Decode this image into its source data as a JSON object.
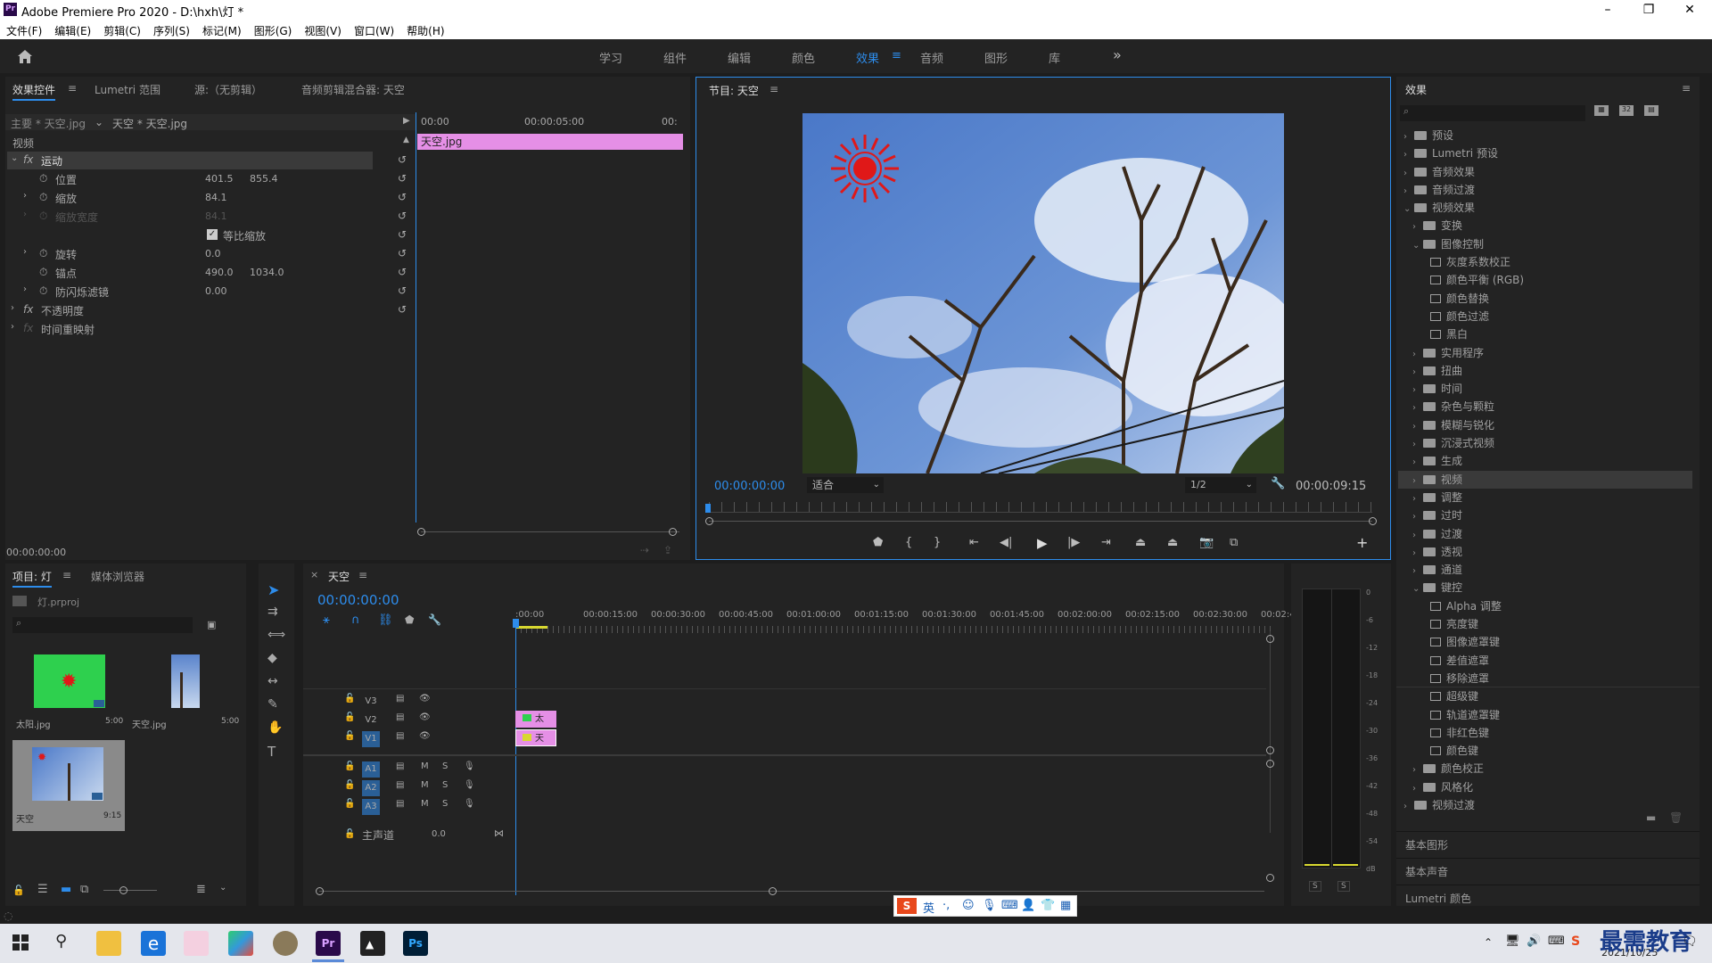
{
  "window": {
    "title": "Adobe Premiere Pro 2020 - D:\\hxh\\灯 *",
    "app_icon": "Pr"
  },
  "menu": [
    "文件(F)",
    "编辑(E)",
    "剪辑(C)",
    "序列(S)",
    "标记(M)",
    "图形(G)",
    "视图(V)",
    "窗口(W)",
    "帮助(H)"
  ],
  "workspaces": {
    "items": [
      "学习",
      "组件",
      "编辑",
      "颜色",
      "效果",
      "音频",
      "图形",
      "库"
    ],
    "active": "效果",
    "more": "»"
  },
  "effect_controls": {
    "tabs": [
      "效果控件",
      "Lumetri 范围",
      "源:（无剪辑）",
      "音频剪辑混合器: 天空"
    ],
    "master_label": "主要 * 天空.jpg",
    "clip_label": "天空 * 天空.jpg",
    "ruler": [
      "00:00",
      "00:00:05:00",
      "00:"
    ],
    "clip_bar": "天空.jpg",
    "section_video": "视频",
    "motion": "运动",
    "props": [
      {
        "name": "位置",
        "v1": "401.5",
        "v2": "855.4"
      },
      {
        "name": "缩放",
        "v1": "84.1",
        "v2": ""
      },
      {
        "name": "缩放宽度",
        "v1": "84.1",
        "v2": ""
      },
      {
        "name": "旋转",
        "v1": "0.0",
        "v2": ""
      },
      {
        "name": "锚点",
        "v1": "490.0",
        "v2": "1034.0"
      },
      {
        "name": "防闪烁滤镜",
        "v1": "0.00",
        "v2": ""
      }
    ],
    "uniform_scale": "等比缩放",
    "opacity": "不透明度",
    "time_remap": "时间重映射",
    "timecode": "00:00:00:00"
  },
  "program": {
    "title": "节目: 天空",
    "timecode_left": "00:00:00:00",
    "fit": "适合",
    "resolution": "1/2",
    "timecode_right": "00:00:09:15"
  },
  "effects_panel": {
    "title": "效果",
    "tree": [
      {
        "level": 0,
        "type": "folder",
        "label": "预设",
        "open": false
      },
      {
        "level": 0,
        "type": "folder",
        "label": "Lumetri 预设",
        "open": false
      },
      {
        "level": 0,
        "type": "folder",
        "label": "音频效果",
        "open": false
      },
      {
        "level": 0,
        "type": "folder",
        "label": "音频过渡",
        "open": false
      },
      {
        "level": 0,
        "type": "folder",
        "label": "视频效果",
        "open": true
      },
      {
        "level": 1,
        "type": "folder",
        "label": "变换",
        "open": false
      },
      {
        "level": 1,
        "type": "folder",
        "label": "图像控制",
        "open": true
      },
      {
        "level": 2,
        "type": "fx",
        "label": "灰度系数校正"
      },
      {
        "level": 2,
        "type": "fx",
        "label": "颜色平衡 (RGB)"
      },
      {
        "level": 2,
        "type": "fx",
        "label": "颜色替换"
      },
      {
        "level": 2,
        "type": "fx",
        "label": "颜色过滤"
      },
      {
        "level": 2,
        "type": "fx",
        "label": "黑白"
      },
      {
        "level": 1,
        "type": "folder",
        "label": "实用程序",
        "open": false
      },
      {
        "level": 1,
        "type": "folder",
        "label": "扭曲",
        "open": false
      },
      {
        "level": 1,
        "type": "folder",
        "label": "时间",
        "open": false
      },
      {
        "level": 1,
        "type": "folder",
        "label": "杂色与颗粒",
        "open": false
      },
      {
        "level": 1,
        "type": "folder",
        "label": "模糊与锐化",
        "open": false
      },
      {
        "level": 1,
        "type": "folder",
        "label": "沉浸式视频",
        "open": false
      },
      {
        "level": 1,
        "type": "folder",
        "label": "生成",
        "open": false
      },
      {
        "level": 1,
        "type": "folder",
        "label": "视频",
        "open": false,
        "selected": true
      },
      {
        "level": 1,
        "type": "folder",
        "label": "调整",
        "open": false
      },
      {
        "level": 1,
        "type": "folder",
        "label": "过时",
        "open": false
      },
      {
        "level": 1,
        "type": "folder",
        "label": "过渡",
        "open": false
      },
      {
        "level": 1,
        "type": "folder",
        "label": "透视",
        "open": false
      },
      {
        "level": 1,
        "type": "folder",
        "label": "通道",
        "open": false
      },
      {
        "level": 1,
        "type": "folder",
        "label": "键控",
        "open": true
      },
      {
        "level": 2,
        "type": "fx",
        "label": "Alpha 调整"
      },
      {
        "level": 2,
        "type": "fx",
        "label": "亮度键"
      },
      {
        "level": 2,
        "type": "fx",
        "label": "图像遮罩键"
      },
      {
        "level": 2,
        "type": "fx",
        "label": "差值遮罩"
      },
      {
        "level": 2,
        "type": "fx",
        "label": "移除遮罩"
      },
      {
        "level": 2,
        "type": "fx",
        "label": "超级键"
      },
      {
        "level": 2,
        "type": "fx",
        "label": "轨道遮罩键"
      },
      {
        "level": 2,
        "type": "fx",
        "label": "非红色键"
      },
      {
        "level": 2,
        "type": "fx",
        "label": "颜色键"
      },
      {
        "level": 1,
        "type": "folder",
        "label": "颜色校正",
        "open": false
      },
      {
        "level": 1,
        "type": "folder",
        "label": "风格化",
        "open": false
      },
      {
        "level": 0,
        "type": "folder",
        "label": "视频过渡",
        "open": false
      }
    ],
    "extra_panels": [
      "基本图形",
      "基本声音",
      "Lumetri 颜色"
    ]
  },
  "project": {
    "tabs": [
      "项目: 灯",
      "媒体浏览器"
    ],
    "file": "灯.prproj",
    "items": [
      {
        "name": "太阳.jpg",
        "duration": "5:00"
      },
      {
        "name": "天空.jpg",
        "duration": "5:00"
      },
      {
        "name": "天空",
        "duration": "9:15"
      }
    ]
  },
  "timeline": {
    "title": "天空",
    "timecode": "00:00:00:00",
    "ruler": [
      ":00:00",
      "00:00:15:00",
      "00:00:30:00",
      "00:00:45:00",
      "00:01:00:00",
      "00:01:15:00",
      "00:01:30:00",
      "00:01:45:00",
      "00:02:00:00",
      "00:02:15:00",
      "00:02:30:00",
      "00:02:45:"
    ],
    "video_tracks": [
      "V3",
      "V2",
      "V1"
    ],
    "audio_tracks": [
      "A1",
      "A2",
      "A3"
    ],
    "master": "主声道",
    "master_value": "0.0",
    "clip_v2": "太",
    "clip_v1": "天"
  },
  "meter": {
    "scale": [
      "0",
      "-6",
      "-12",
      "-18",
      "-24",
      "-30",
      "-36",
      "-42",
      "-48",
      "-54",
      "dB"
    ],
    "solo": [
      "S",
      "S"
    ]
  },
  "ime": {
    "lang": "英"
  },
  "taskbar": {
    "date": "2021/10/25",
    "watermark": "最需教育"
  }
}
